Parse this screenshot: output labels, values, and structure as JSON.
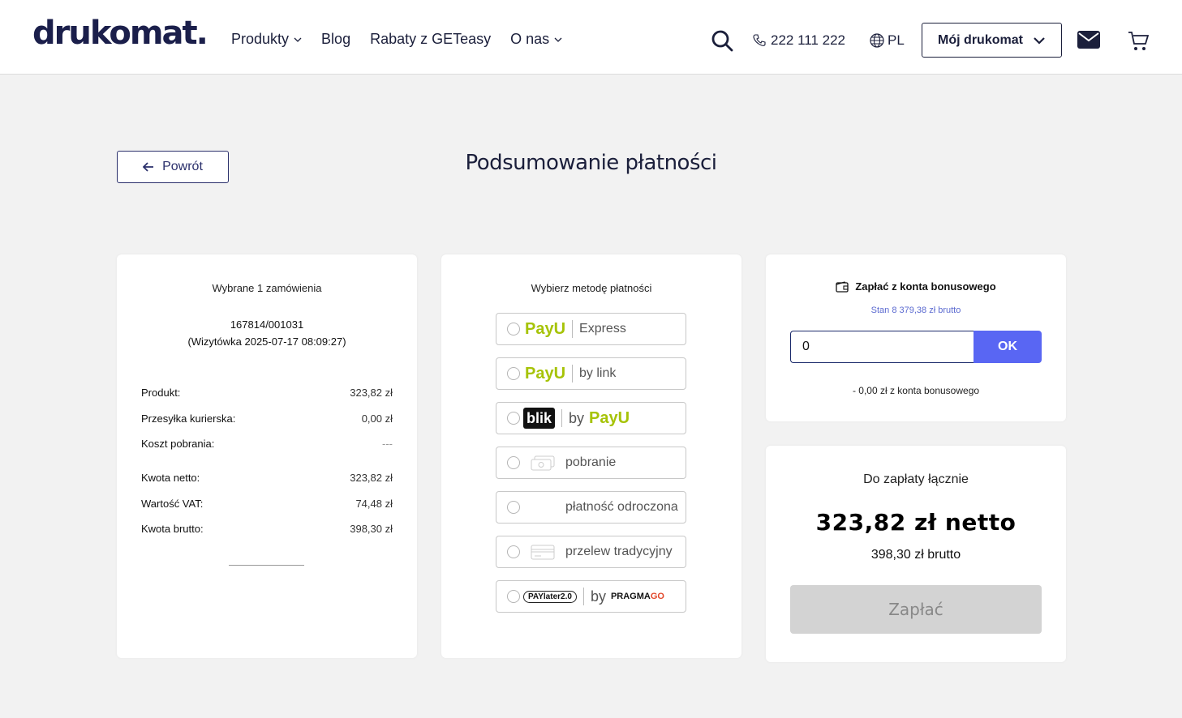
{
  "header": {
    "logo": "drukomat.",
    "nav": [
      {
        "label": "Produkty",
        "has_dropdown": true
      },
      {
        "label": "Blog",
        "has_dropdown": false
      },
      {
        "label": "Rabaty z GETeasy",
        "has_dropdown": false
      },
      {
        "label": "O nas",
        "has_dropdown": true
      }
    ],
    "phone": "222 111 222",
    "language": "PL",
    "account_label": "Mój drukomat",
    "icons": [
      "search-icon",
      "phone-icon",
      "globe-icon",
      "chevron-down-icon",
      "mail-icon",
      "cart-icon"
    ]
  },
  "back_label": "Powrót",
  "page_title": "Podsumowanie płatności",
  "summary": {
    "heading": "Wybrane 1 zamówienia",
    "order_id": "167814/001031",
    "order_desc": "(Wizytówka 2025-07-17 08:09:27)",
    "rows": [
      {
        "label": "Produkt:",
        "value": "323,82 zł"
      },
      {
        "label": "Przesyłka kurierska:",
        "value": "0,00 zł"
      },
      {
        "label": "Koszt pobrania:",
        "value": "---"
      },
      {
        "label": "Kwota netto:",
        "value": "323,82 zł"
      },
      {
        "label": "Wartość VAT:",
        "value": "74,48 zł"
      },
      {
        "label": "Kwota brutto:",
        "value": "398,30 zł"
      }
    ]
  },
  "payment": {
    "heading": "Wybierz metodę płatności",
    "methods": [
      {
        "brand": "PayU",
        "label": "Express"
      },
      {
        "brand": "PayU",
        "label": "by link"
      },
      {
        "brand": "blik",
        "by": "by",
        "brand2": "PayU"
      },
      {
        "label": "pobranie",
        "icon": "cash-icon"
      },
      {
        "label": "płatność odroczona"
      },
      {
        "label": "przelew tradycyjny",
        "icon": "card-icon"
      },
      {
        "brand": "PAYlater2.0",
        "by": "by",
        "brand2_a": "PRAGMA",
        "brand2_b": "GO"
      }
    ]
  },
  "bonus": {
    "heading": "Zapłać z konta bonusowego",
    "balance": "Stan 8 379,38 zł brutto",
    "input_value": "0",
    "ok_label": "OK",
    "deduction": "- 0,00 zł z konta bonusowego"
  },
  "total": {
    "heading": "Do zapłaty łącznie",
    "net": "323,82 zł netto",
    "gross": "398,30 zł brutto",
    "pay_label": "Zapłać"
  },
  "colors": {
    "accent": "#5966f3",
    "navy": "#1b1f3b",
    "payu_green": "#a6c307",
    "disabled": "#d3d3d3"
  }
}
